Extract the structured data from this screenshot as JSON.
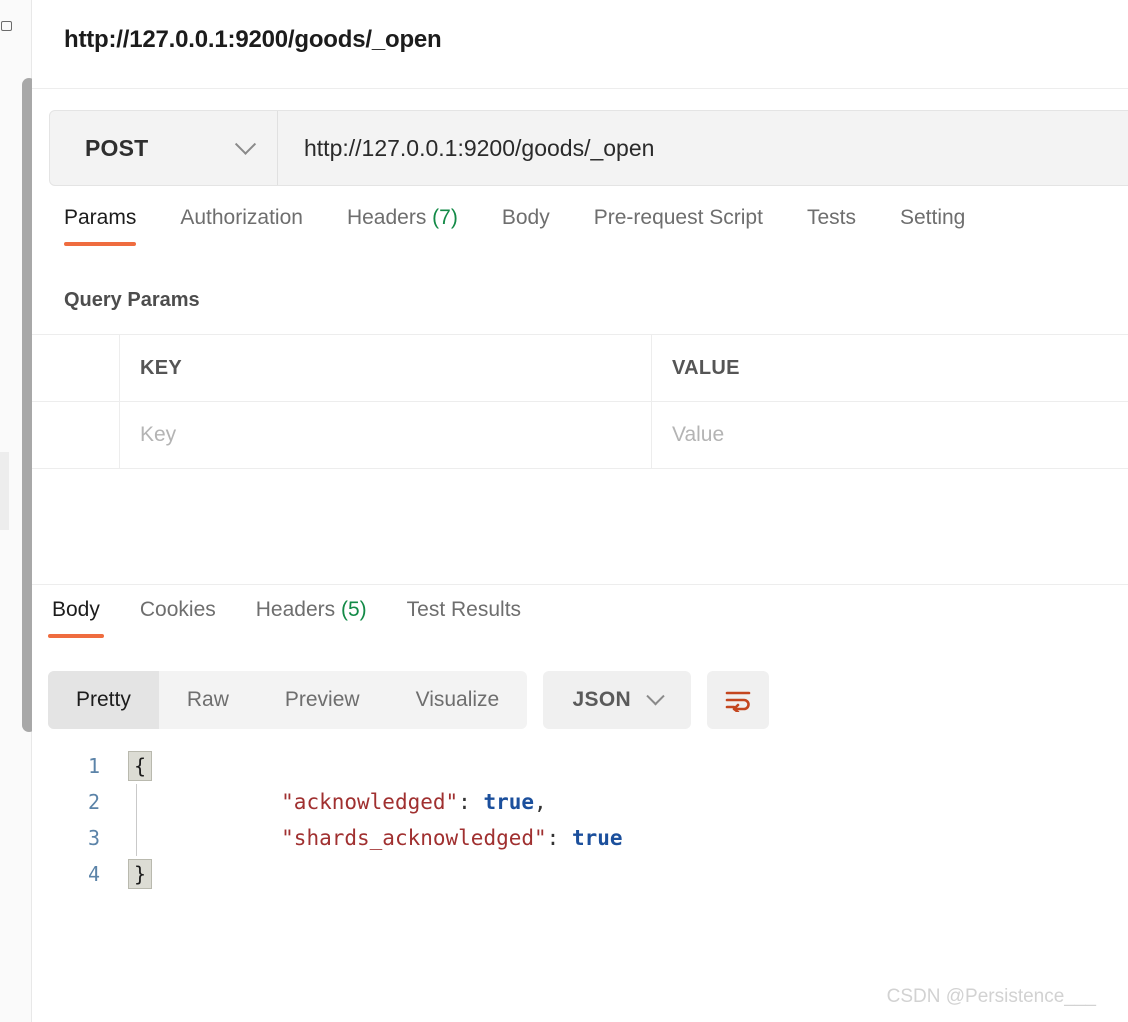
{
  "request": {
    "title": "http://127.0.0.1:9200/goods/_open",
    "method": "POST",
    "url": "http://127.0.0.1:9200/goods/_open",
    "method_chevron_icon": "chevron-down-icon",
    "tabs": [
      {
        "label": "Params",
        "count": "",
        "active": true
      },
      {
        "label": "Authorization",
        "count": "",
        "active": false
      },
      {
        "label": "Headers",
        "count": "(7)",
        "active": false
      },
      {
        "label": "Body",
        "count": "",
        "active": false
      },
      {
        "label": "Pre-request Script",
        "count": "",
        "active": false
      },
      {
        "label": "Tests",
        "count": "",
        "active": false
      },
      {
        "label": "Setting",
        "count": "",
        "active": false
      }
    ],
    "query_params": {
      "section_label": "Query Params",
      "columns": [
        "KEY",
        "VALUE"
      ],
      "rows": [
        {
          "key_placeholder": "Key",
          "value_placeholder": "Value"
        }
      ]
    }
  },
  "response": {
    "tabs": [
      {
        "label": "Body",
        "count": "",
        "active": true
      },
      {
        "label": "Cookies",
        "count": "",
        "active": false
      },
      {
        "label": "Headers",
        "count": "(5)",
        "active": false
      },
      {
        "label": "Test Results",
        "count": "",
        "active": false
      }
    ],
    "view_modes": [
      {
        "label": "Pretty",
        "active": true
      },
      {
        "label": "Raw",
        "active": false
      },
      {
        "label": "Preview",
        "active": false
      },
      {
        "label": "Visualize",
        "active": false
      }
    ],
    "format": "JSON",
    "format_chevron_icon": "chevron-down-icon",
    "wrap_icon": "word-wrap-icon",
    "body_lines": [
      {
        "num": "1",
        "fold": "{",
        "text": ""
      },
      {
        "num": "2",
        "fold": "",
        "key": "\"acknowledged\"",
        "punc": ": ",
        "bool": "true",
        "tail": ","
      },
      {
        "num": "3",
        "fold": "",
        "key": "\"shards_acknowledged\"",
        "punc": ": ",
        "bool": "true",
        "tail": ""
      },
      {
        "num": "4",
        "fold": "}",
        "text": ""
      }
    ]
  },
  "watermark": "CSDN @Persistence___",
  "colors": {
    "accent": "#ef6c3f",
    "count_green": "#138a47",
    "json_key": "#a03030",
    "json_bool": "#1b4f9c",
    "gutter_num": "#5b83a8"
  }
}
